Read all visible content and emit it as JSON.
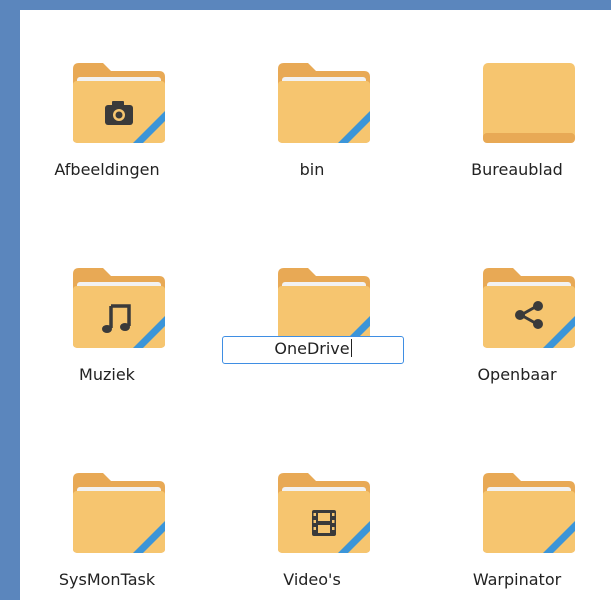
{
  "folders": [
    {
      "name": "Afbeeldingen",
      "emblem": "camera-icon",
      "link": true
    },
    {
      "name": "bin",
      "emblem": "",
      "link": true
    },
    {
      "name": "Bureaublad",
      "emblem": "desktop-folder-icon",
      "link": false
    },
    {
      "name": "Muziek",
      "emblem": "music-note-icon",
      "link": true
    },
    {
      "name": "OneDrive",
      "emblem": "",
      "link": true,
      "renaming": true
    },
    {
      "name": "Openbaar",
      "emblem": "share-icon",
      "link": true
    },
    {
      "name": "SysMonTask",
      "emblem": "",
      "link": true
    },
    {
      "name": "Video's",
      "emblem": "film-icon",
      "link": true
    },
    {
      "name": "Warpinator",
      "emblem": "",
      "link": true
    }
  ],
  "rename": {
    "value": "OneDrive"
  },
  "colors": {
    "folder_back": "#e8a955",
    "folder_front": "#f6c56f",
    "paper": "#f2f2f2",
    "link_stripe": "#3b95d9",
    "emblem": "#3a3a3a",
    "background": "#5b86bd"
  }
}
